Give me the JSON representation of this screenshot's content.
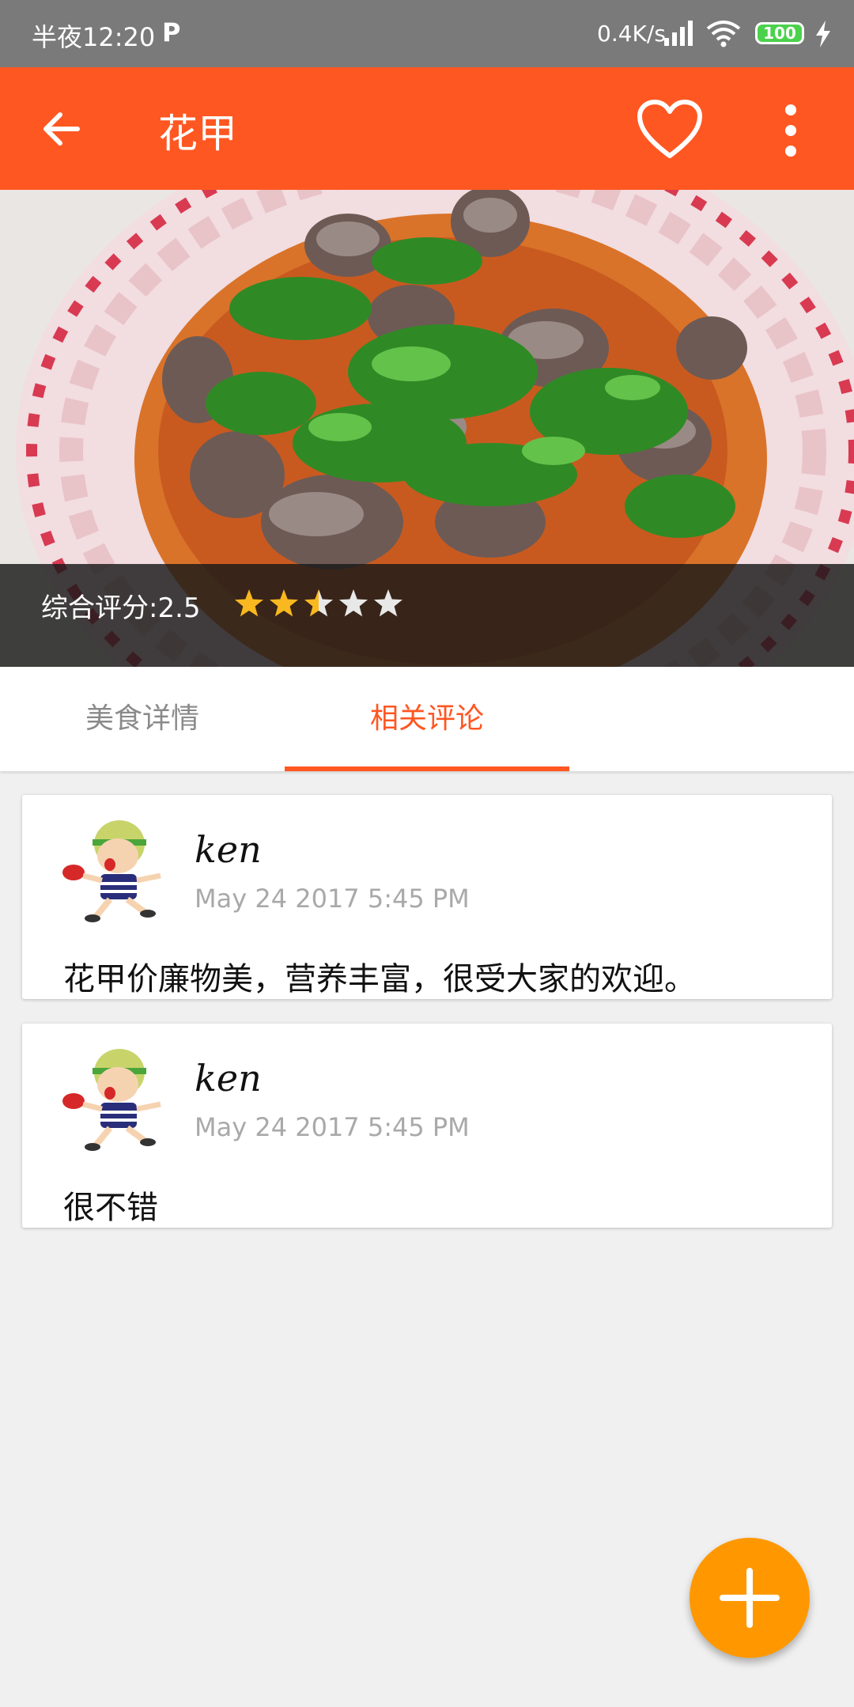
{
  "status_bar": {
    "time": "半夜12:20",
    "p_icon": "P",
    "network_speed": "0.4K/s",
    "battery": "100",
    "icons": [
      "signal-icon",
      "wifi-icon",
      "battery-icon",
      "charging-icon"
    ]
  },
  "toolbar": {
    "title": "花甲",
    "icons": [
      "back-arrow-icon",
      "heart-icon",
      "more-vert-icon"
    ]
  },
  "hero": {
    "rating_label": "综合评分:2.5",
    "rating": 2.5,
    "rating_max": 5
  },
  "tabs": [
    {
      "label": "美食详情",
      "active": false
    },
    {
      "label": "相关评论",
      "active": true
    }
  ],
  "comments": [
    {
      "name": "ken",
      "time": "May 24 2017 5:45 PM",
      "text": "花甲价廉物美，营养丰富，很受大家的欢迎。"
    },
    {
      "name": "ken",
      "time": "May 24 2017 5:45 PM",
      "text": "很不错"
    }
  ],
  "fab": {
    "icon": "plus-icon"
  },
  "colors": {
    "primary": "#ff5722",
    "fab": "#ff9800",
    "star": "#f9b820",
    "tab_inactive": "#8a8a8a"
  }
}
